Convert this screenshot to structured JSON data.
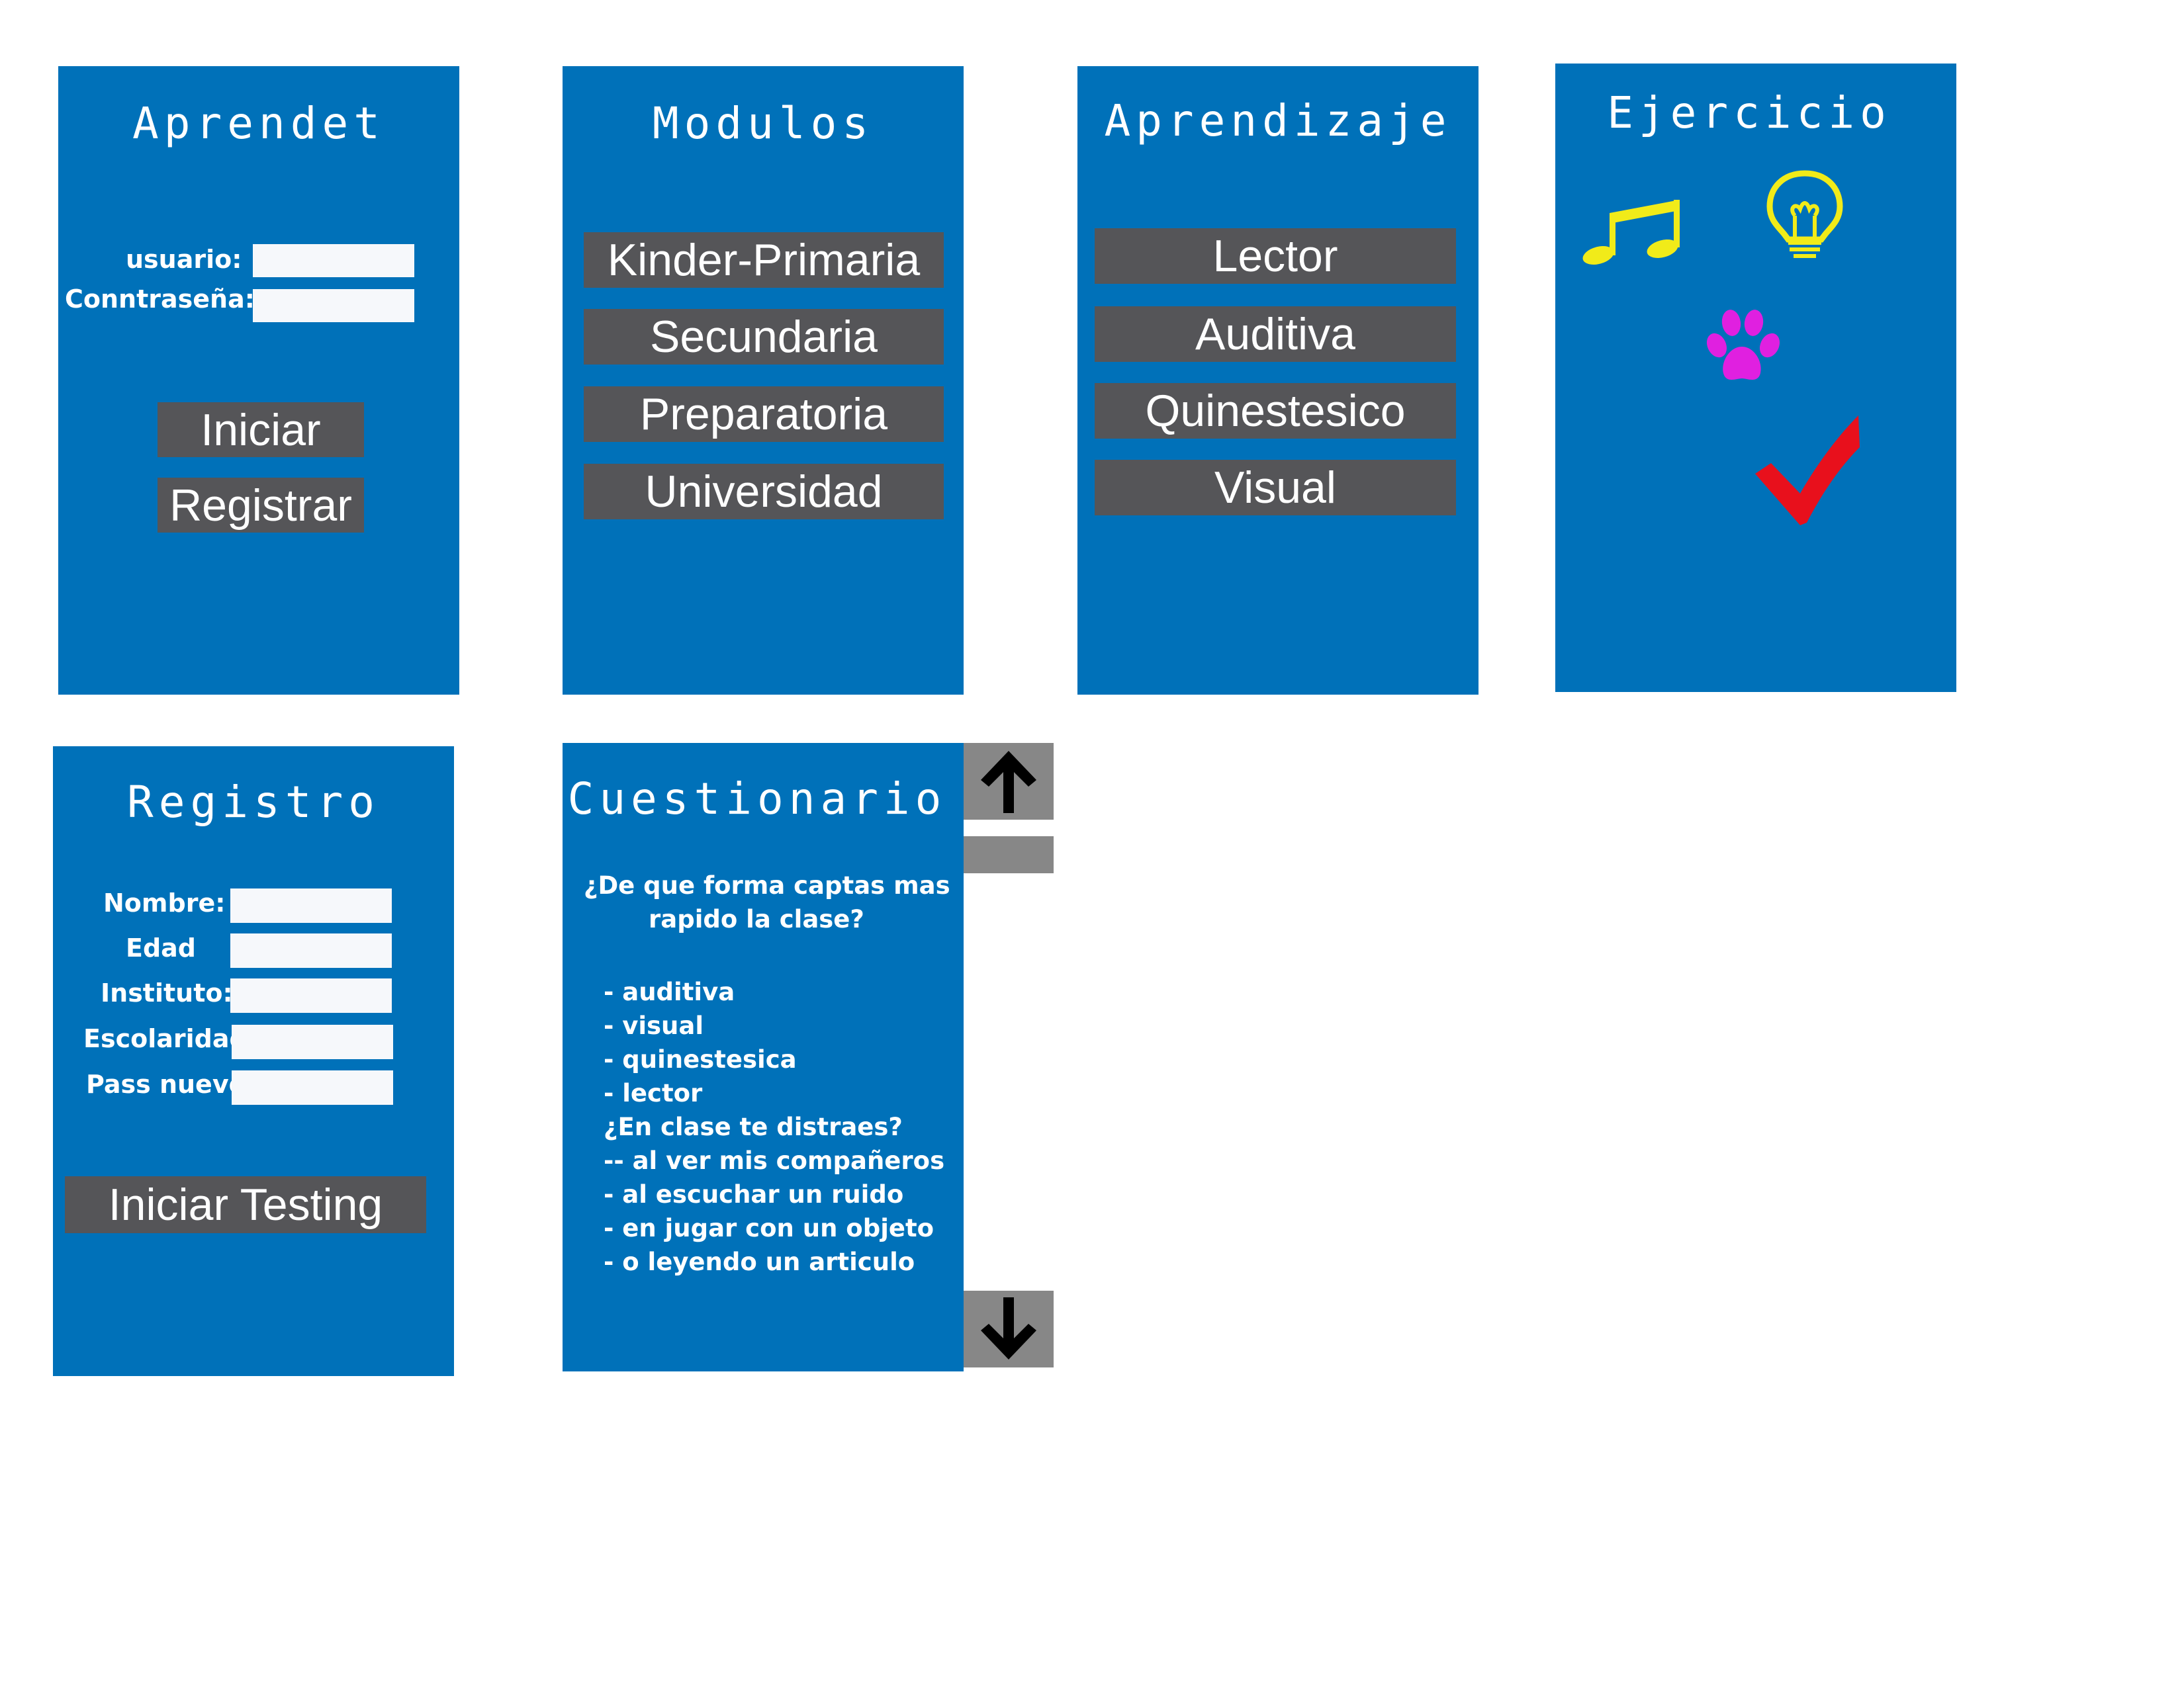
{
  "login": {
    "title": "Aprendet",
    "user_label": "usuario:",
    "pass_label": "Conntraseña:",
    "user_value": "",
    "pass_value": "",
    "start_label": "Iniciar",
    "register_label": "Registrar"
  },
  "modules": {
    "title": "Modulos",
    "items": [
      "Kinder-Primaria",
      "Secundaria",
      "Preparatoria",
      "Universidad"
    ]
  },
  "learning": {
    "title": "Aprendizaje",
    "items": [
      "Lector",
      "Auditiva",
      "Quinestesico",
      "Visual"
    ]
  },
  "exercise": {
    "title": "Ejercicio",
    "icons": [
      "music-note-icon",
      "lightbulb-icon",
      "paw-icon",
      "checkmark-icon"
    ],
    "colors": {
      "music": "#f1eb19",
      "bulb": "#f1eb19",
      "paw": "#e020e0",
      "check": "#e8101c"
    }
  },
  "registration": {
    "title": "Registro",
    "fields": [
      {
        "label": "Nombre:",
        "value": ""
      },
      {
        "label": "Edad",
        "value": ""
      },
      {
        "label": "Instituto:",
        "value": ""
      },
      {
        "label": "Escolaridad:",
        "value": ""
      },
      {
        "label": "Pass nuevo:",
        "value": ""
      }
    ],
    "submit_label": "Iniciar Testing"
  },
  "questionnaire": {
    "title": "Cuestionario",
    "question1_line1": "¿De que forma captas mas",
    "question1_line2": "rapido la clase?",
    "lines": [
      "- auditiva",
      "- visual",
      "- quinestesica",
      "- lector",
      "¿En clase te distraes?",
      "-- al ver mis compañeros",
      "- al escuchar un ruido",
      "- en jugar con un objeto",
      "- o leyendo un articulo"
    ]
  },
  "colors": {
    "panel": "#0071b9",
    "button": "#555558",
    "scroll": "#878787"
  }
}
